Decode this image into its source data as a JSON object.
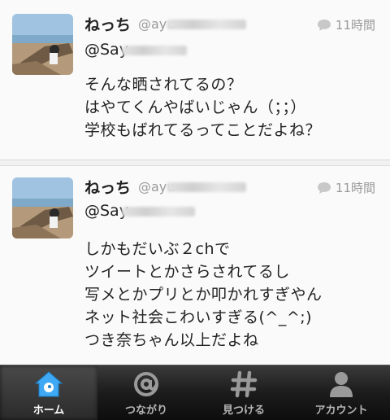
{
  "tweets": [
    {
      "name": "ねっち",
      "handle": "@ayu",
      "time": "11時間",
      "mention": "@Say",
      "body": "そんな晒されてるの？\nはやてくんやばいじゃん（；；）\n学校もばれてるってことだよね？"
    },
    {
      "name": "ねっち",
      "handle": "@ayu",
      "time": "11時間",
      "mention": "@Say",
      "body": "しかもだいぶ２chで\nツイートとかさらされてるし\n写メとかプリとか叩かれすぎやん\nネット社会こわいすぎる(^_^;)\nつき奈ちゃん以上だよね"
    }
  ],
  "tabbar": {
    "items": [
      {
        "label": "ホーム",
        "icon": "home-bird-icon",
        "active": true
      },
      {
        "label": "つながり",
        "icon": "at-icon",
        "active": false
      },
      {
        "label": "見つける",
        "icon": "hash-icon",
        "active": false
      },
      {
        "label": "アカウント",
        "icon": "person-icon",
        "active": false
      }
    ]
  },
  "colors": {
    "accent": "#1da1f2",
    "tabbar": "#1c1c1c",
    "text": "#222222",
    "meta": "#9a9a9a"
  }
}
